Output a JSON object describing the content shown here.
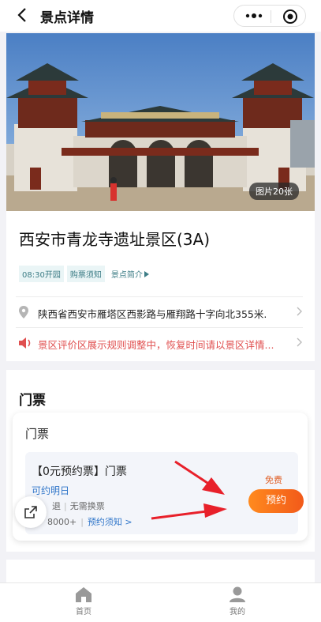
{
  "nav": {
    "title": "景点详情"
  },
  "hero": {
    "photo_count": "图片20张"
  },
  "spot": {
    "name": "西安市青龙寺遗址景区(3A)",
    "tags": [
      "08:30开园",
      "购票须知"
    ],
    "intro_link": "景点简介",
    "address": "陕西省西安市雁塔区西影路与雁翔路十字向北355米.",
    "notice": "景区评价区展示规则调整中，恢复时间请以景区详情..."
  },
  "ticket": {
    "section_title": "门票",
    "card_title": "门票",
    "item": {
      "name": "【0元预约票】门票",
      "availability": "可约明日",
      "refund": "退",
      "exchange": "无需换票",
      "sales": "8000+",
      "notes_link": "预约须知 >",
      "price": "免费",
      "book_label": "预约"
    }
  },
  "tabbar": {
    "home": "首页",
    "mine": "我的"
  },
  "icons": {
    "back": "back-arrow-icon",
    "more": "more-dots-icon",
    "close": "target-circle-icon",
    "location": "location-pin-icon",
    "speaker": "speaker-icon",
    "share": "share-icon",
    "home": "home-icon",
    "user": "user-icon"
  },
  "colors": {
    "accent": "#f25a1a",
    "link": "#2f75c9",
    "notice": "#e05050",
    "tag": "#3d7d86",
    "annotation": "#e8202a"
  }
}
